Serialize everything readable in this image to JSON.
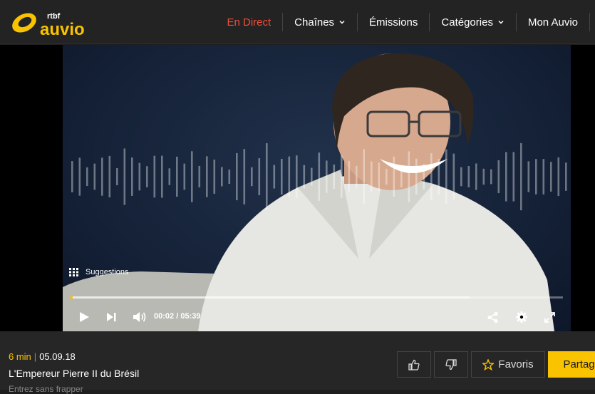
{
  "brand": {
    "small": "rtbf",
    "large": "auvio",
    "accent": "#f9c300"
  },
  "nav": {
    "items": [
      {
        "label": "En Direct",
        "live": true,
        "dropdown": false
      },
      {
        "label": "Chaînes",
        "live": false,
        "dropdown": true
      },
      {
        "label": "Émissions",
        "live": false,
        "dropdown": false
      },
      {
        "label": "Catégories",
        "live": false,
        "dropdown": true
      },
      {
        "label": "Mon Auvio",
        "live": false,
        "dropdown": false
      }
    ],
    "live_color": "#ef4e3a"
  },
  "player": {
    "suggestions_label": "Suggestions",
    "current_time": "00:02",
    "time_separator": "/",
    "duration": "05:39",
    "played_fraction": 0.006,
    "buffered_fraction": 0.81,
    "controls": [
      "play-icon",
      "next-icon",
      "volume-icon",
      "share-icon",
      "gear-icon",
      "fullscreen-icon"
    ]
  },
  "episode": {
    "duration": "6 min",
    "date": "05.09.18",
    "title": "L'Empereur Pierre II du Brésil",
    "program": "Entrez sans frapper"
  },
  "actions": {
    "favorite_label": "Favoris",
    "share_label": "Partager"
  }
}
